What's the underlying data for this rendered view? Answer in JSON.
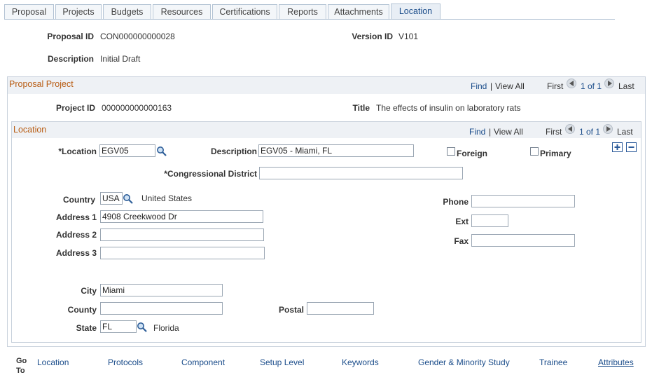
{
  "tabs": [
    {
      "label": "Proposal"
    },
    {
      "label": "Projects"
    },
    {
      "label": "Budgets"
    },
    {
      "label": "Resources"
    },
    {
      "label": "Certifications"
    },
    {
      "label": "Reports"
    },
    {
      "label": "Attachments"
    },
    {
      "label": "Location"
    }
  ],
  "header": {
    "proposal_id_label": "Proposal ID",
    "proposal_id": "CON000000000028",
    "version_id_label": "Version ID",
    "version_id": "V101",
    "description_label": "Description",
    "description": "Initial Draft"
  },
  "project_section": {
    "title": "Proposal Project",
    "find": "Find",
    "sep": "|",
    "view_all": "View All",
    "first": "First",
    "count": "1 of 1",
    "last": "Last",
    "project_id_label": "Project ID",
    "project_id": "000000000000163",
    "title_label": "Title",
    "title_value": "The effects of insulin on laboratory rats"
  },
  "location_section": {
    "title": "Location",
    "find": "Find",
    "sep": "|",
    "view_all": "View All",
    "first": "First",
    "count": "1 of 1",
    "last": "Last",
    "location_label": "*Location",
    "location_value": "EGV05",
    "description_label": "Description",
    "description_value": "EGV05 - Miami,  FL",
    "foreign_label": "Foreign",
    "primary_label": "Primary",
    "add_symbol": "+",
    "remove_symbol": "−",
    "congressional_label": "*Congressional District",
    "congressional_value": "",
    "country_label": "Country",
    "country_value": "USA",
    "country_name": "United States",
    "address1_label": "Address 1",
    "address1_value": "4908 Creekwood Dr",
    "address2_label": "Address 2",
    "address2_value": "",
    "address3_label": "Address 3",
    "address3_value": "",
    "phone_label": "Phone",
    "phone_value": "",
    "ext_label": "Ext",
    "ext_value": "",
    "fax_label": "Fax",
    "fax_value": "",
    "city_label": "City",
    "city_value": "Miami",
    "county_label": "County",
    "county_value": "",
    "postal_label": "Postal",
    "postal_value": "",
    "state_label": "State",
    "state_value": "FL",
    "state_name": "Florida"
  },
  "goto": {
    "label_line1": "Go",
    "label_line2": "To",
    "links": [
      {
        "label": "Location"
      },
      {
        "label": "Protocols"
      },
      {
        "label": "Component"
      },
      {
        "label": "Setup Level"
      },
      {
        "label": "Keywords"
      },
      {
        "label": "Gender & Minority Study"
      },
      {
        "label": "Trainee"
      },
      {
        "label": "Attributes"
      }
    ]
  },
  "colors": {
    "accent": "#1a4c8a",
    "section_title": "#b85c12"
  }
}
